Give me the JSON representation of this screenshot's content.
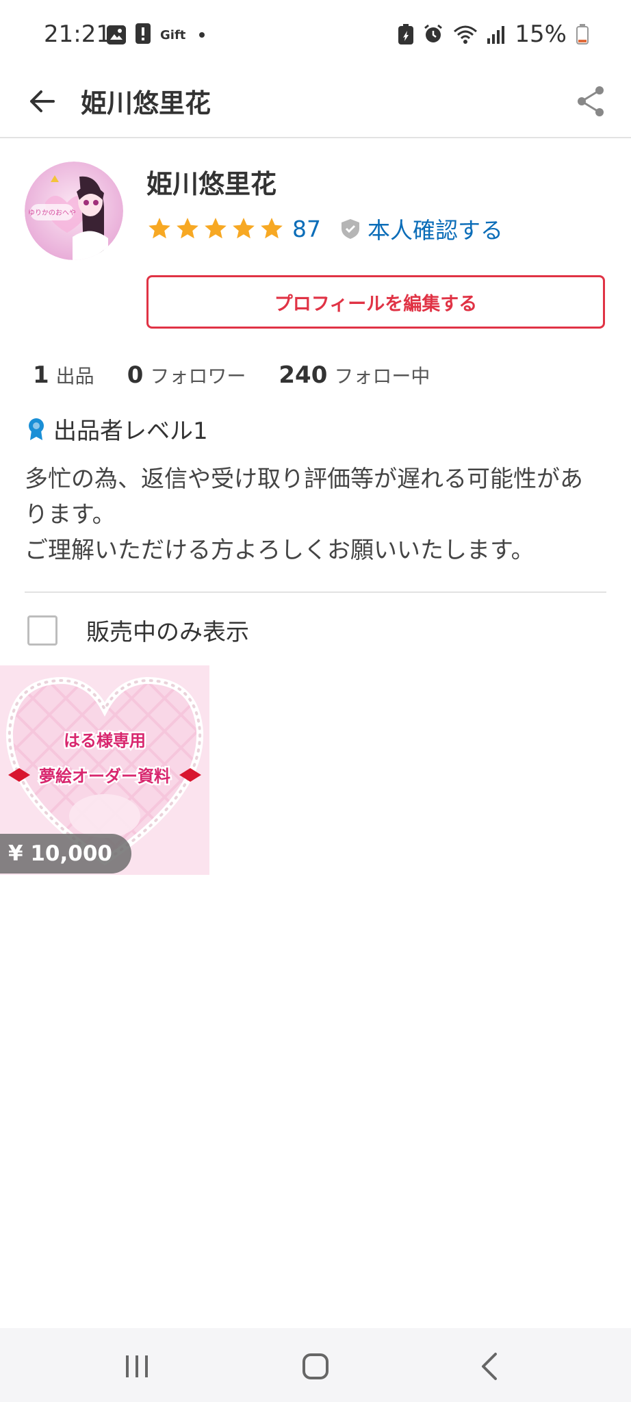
{
  "status_bar": {
    "time": "21:21",
    "gift_label": "Gift",
    "battery": "15%"
  },
  "app_bar": {
    "title": "姫川悠里花",
    "back_icon": "arrow-left-icon",
    "share_icon": "share-icon"
  },
  "profile": {
    "name": "姫川悠里花",
    "rating_stars": 5,
    "rating_count": "87",
    "verify_label": "本人確認する",
    "edit_button": "プロフィールを編集する",
    "stats": [
      {
        "value": "1",
        "label": "出品"
      },
      {
        "value": "0",
        "label": "フォロワー"
      },
      {
        "value": "240",
        "label": "フォロー中"
      }
    ],
    "level": "出品者レベル1",
    "bio_lines": [
      "多忙の為、返信や受け取り評価等が遅れる可能性があ",
      "ります。",
      "ご理解いただける方よろしくお願いいたします。"
    ],
    "avatar_text": "ゆりかのおへや"
  },
  "filter": {
    "label": "販売中のみ表示",
    "checked": false
  },
  "items": [
    {
      "line1": "はる様専用",
      "line2": "夢絵オーダー資料",
      "price": "¥ 10,000"
    }
  ],
  "colors": {
    "accent_red": "#e03345",
    "link_blue": "#0b6db8",
    "star": "#f7a823"
  }
}
